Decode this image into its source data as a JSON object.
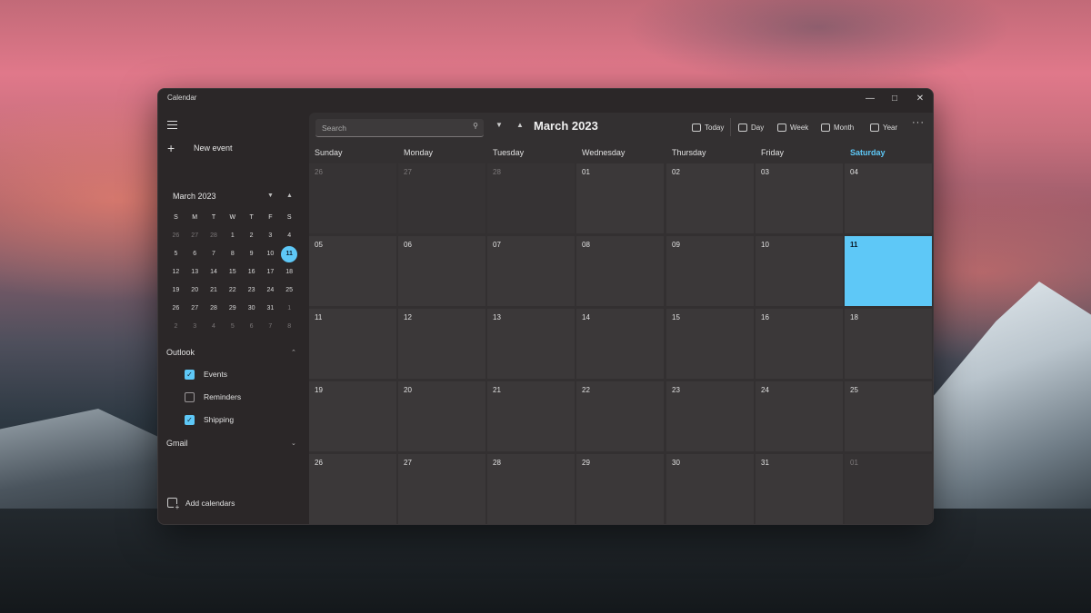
{
  "window": {
    "title": "Calendar"
  },
  "sidebar": {
    "new_event_label": "New event",
    "mini_calendar": {
      "month_label": "March 2023",
      "weekday_headers": [
        "S",
        "M",
        "T",
        "W",
        "T",
        "F",
        "S"
      ],
      "weeks": [
        [
          "26",
          "27",
          "28",
          "1",
          "2",
          "3",
          "4"
        ],
        [
          "5",
          "6",
          "7",
          "8",
          "9",
          "10",
          "11"
        ],
        [
          "12",
          "13",
          "14",
          "15",
          "16",
          "17",
          "18"
        ],
        [
          "19",
          "20",
          "21",
          "22",
          "23",
          "24",
          "25"
        ],
        [
          "26",
          "27",
          "28",
          "29",
          "30",
          "31",
          "1"
        ],
        [
          "2",
          "3",
          "4",
          "5",
          "6",
          "7",
          "8"
        ]
      ],
      "selected_day": "11"
    },
    "groups": [
      {
        "label": "Outlook",
        "expanded": true,
        "calendars": [
          {
            "label": "Events",
            "checked": true
          },
          {
            "label": "Reminders",
            "checked": false
          },
          {
            "label": "Shipping",
            "checked": true
          }
        ]
      },
      {
        "label": "Gmail",
        "expanded": false,
        "calendars": []
      }
    ],
    "add_calendars_label": "Add calendars",
    "bottom_nav": [
      "mail-icon",
      "calendar-icon",
      "people-icon",
      "todo-icon",
      "settings-icon"
    ]
  },
  "toolbar": {
    "search_placeholder": "Search",
    "month_title": "March 2023",
    "views": {
      "today": "Today",
      "day": "Day",
      "week": "Week",
      "month": "Month",
      "year": "Year"
    },
    "more": "···"
  },
  "month_view": {
    "weekdays": [
      "Sunday",
      "Monday",
      "Tuesday",
      "Wednesday",
      "Thursday",
      "Friday",
      "Saturday"
    ],
    "weeks": [
      [
        "26",
        "27",
        "28",
        "01",
        "02",
        "03",
        "04"
      ],
      [
        "05",
        "06",
        "07",
        "08",
        "09",
        "10",
        "11"
      ],
      [
        "11",
        "12",
        "13",
        "14",
        "15",
        "16",
        "18"
      ],
      [
        "19",
        "20",
        "21",
        "22",
        "23",
        "24",
        "25"
      ],
      [
        "26",
        "27",
        "28",
        "29",
        "30",
        "31",
        "01"
      ]
    ],
    "today": "11"
  },
  "colors": {
    "accent": "#5ec8f7",
    "window_bg": "#2b2728",
    "cell_bg": "#3b3839"
  }
}
